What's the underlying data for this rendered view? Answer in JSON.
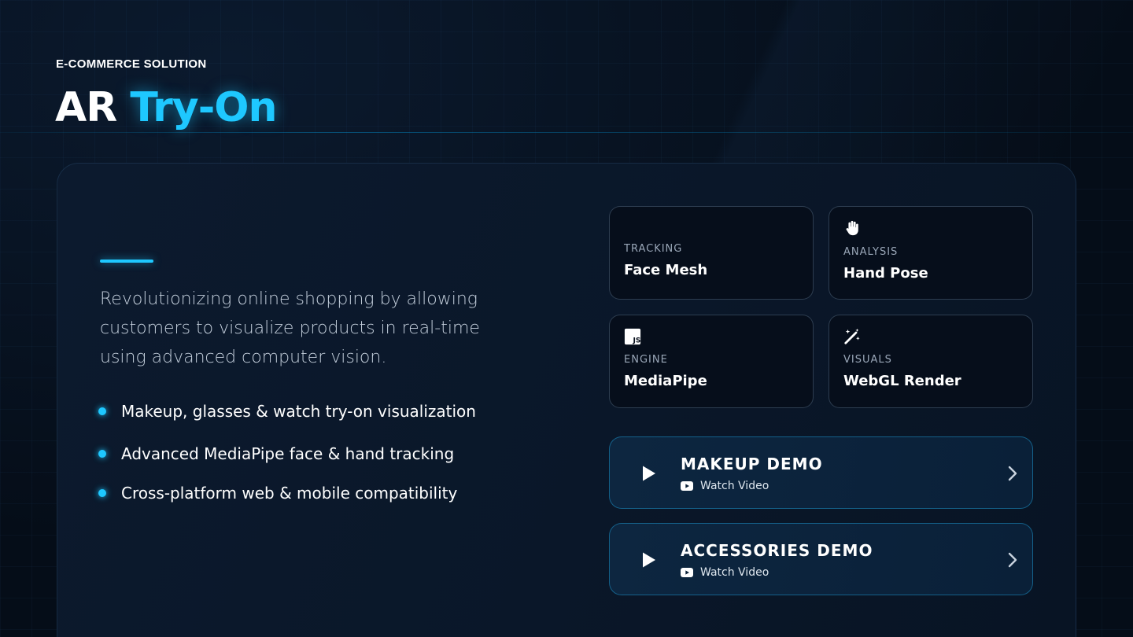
{
  "header": {
    "eyebrow": "E-COMMERCE SOLUTION",
    "title_plain": "AR",
    "title_accent": "Try-On"
  },
  "intro": {
    "description": "Revolutionizing online shopping by allowing customers to visualize products in real-time using advanced computer vision."
  },
  "features": [
    "Makeup, glasses & watch try-on visualization",
    "Advanced MediaPipe face & hand tracking",
    "Cross-platform web & mobile compatibility"
  ],
  "tiles": [
    {
      "label": "TRACKING",
      "value": "Face Mesh",
      "icon": "none"
    },
    {
      "label": "ANALYSIS",
      "value": "Hand Pose",
      "icon": "hand-icon"
    },
    {
      "label": "ENGINE",
      "value": "MediaPipe",
      "icon": "js-icon"
    },
    {
      "label": "VISUALS",
      "value": "WebGL Render",
      "icon": "magic-wand-icon"
    }
  ],
  "demos": [
    {
      "title": "MAKEUP DEMO",
      "action": "Watch Video"
    },
    {
      "title": "ACCESSORIES DEMO",
      "action": "Watch Video"
    }
  ],
  "colors": {
    "accent": "#1ec8ff",
    "background": "#050d18",
    "panel": "#0a1729"
  }
}
